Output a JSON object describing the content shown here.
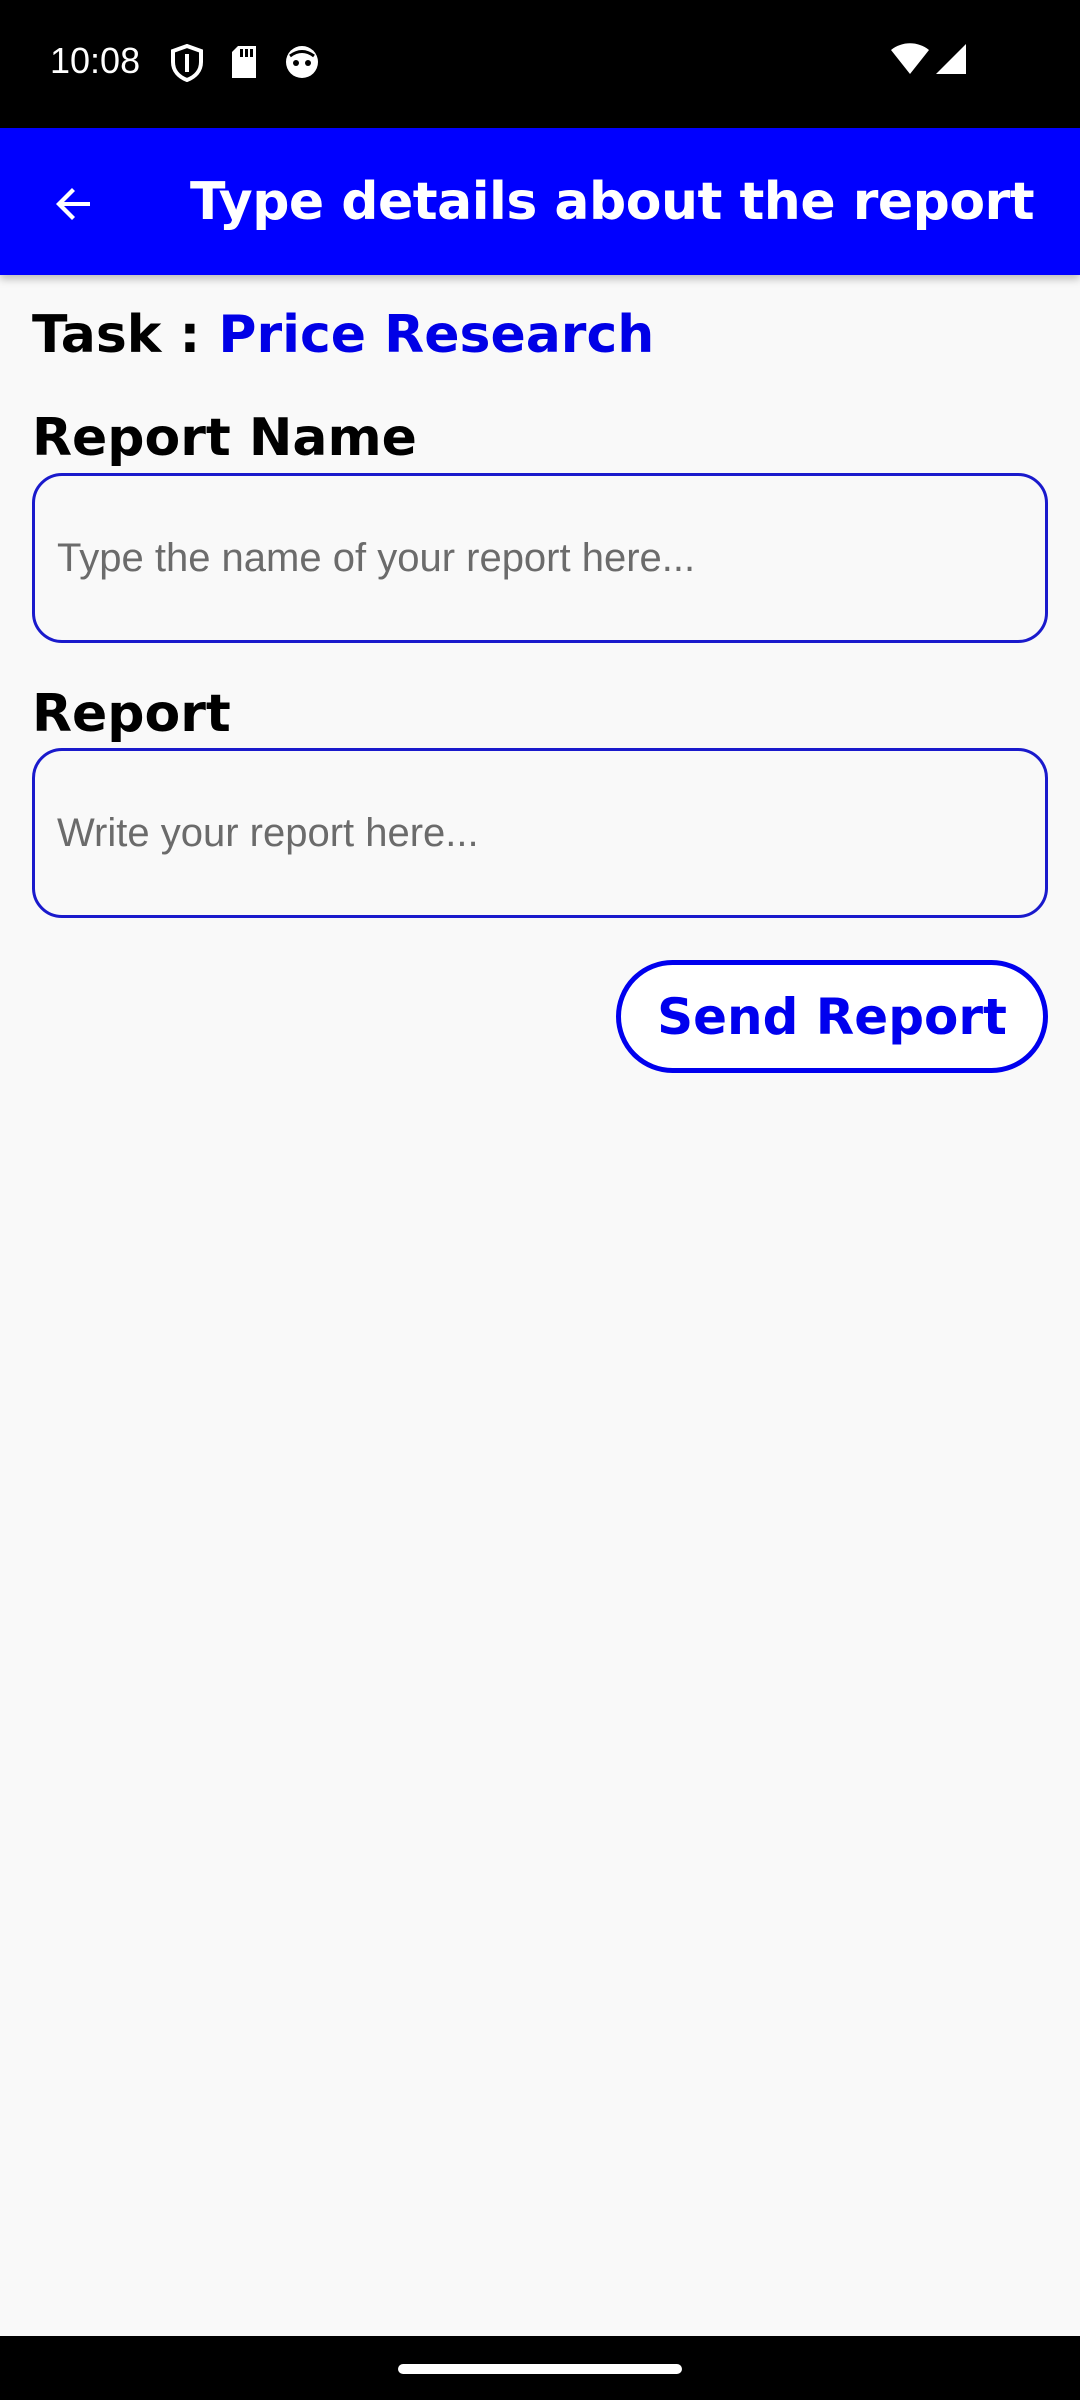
{
  "status_bar": {
    "time": "10:08",
    "icons": [
      "shield-icon",
      "sd-card-icon",
      "face-icon",
      "wifi-icon",
      "signal-icon"
    ]
  },
  "app_bar": {
    "back_icon": "arrow-back-icon",
    "title": "Type details about the report",
    "background": "#0000ff"
  },
  "task": {
    "prefix": "Task : ",
    "name": "Price Research",
    "name_color": "#0000e6"
  },
  "fields": {
    "report_name": {
      "label": "Report Name",
      "value": "",
      "placeholder": "Type the name of your report here..."
    },
    "report": {
      "label": "Report",
      "value": "",
      "placeholder": "Write your report here..."
    }
  },
  "send_button": {
    "label": "Send Report",
    "color": "#0000ee"
  }
}
